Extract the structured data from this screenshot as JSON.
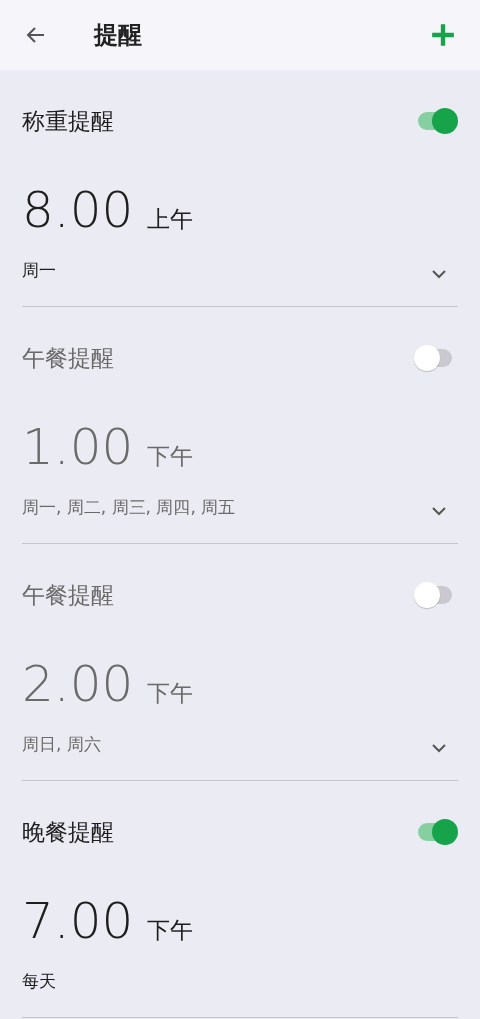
{
  "header": {
    "title": "提醒"
  },
  "reminders": [
    {
      "title": "称重提醒",
      "on": true,
      "time": "8.00",
      "period": "上午",
      "days": "周一",
      "chevron": true
    },
    {
      "title": "午餐提醒",
      "on": false,
      "time": "1.00",
      "period": "下午",
      "days": "周一, 周二, 周三, 周四, 周五",
      "chevron": true
    },
    {
      "title": "午餐提醒",
      "on": false,
      "time": "2.00",
      "period": "下午",
      "days": "周日, 周六",
      "chevron": true
    },
    {
      "title": "晚餐提醒",
      "on": true,
      "time": "7.00",
      "period": "下午",
      "days": "每天",
      "chevron": false
    }
  ]
}
